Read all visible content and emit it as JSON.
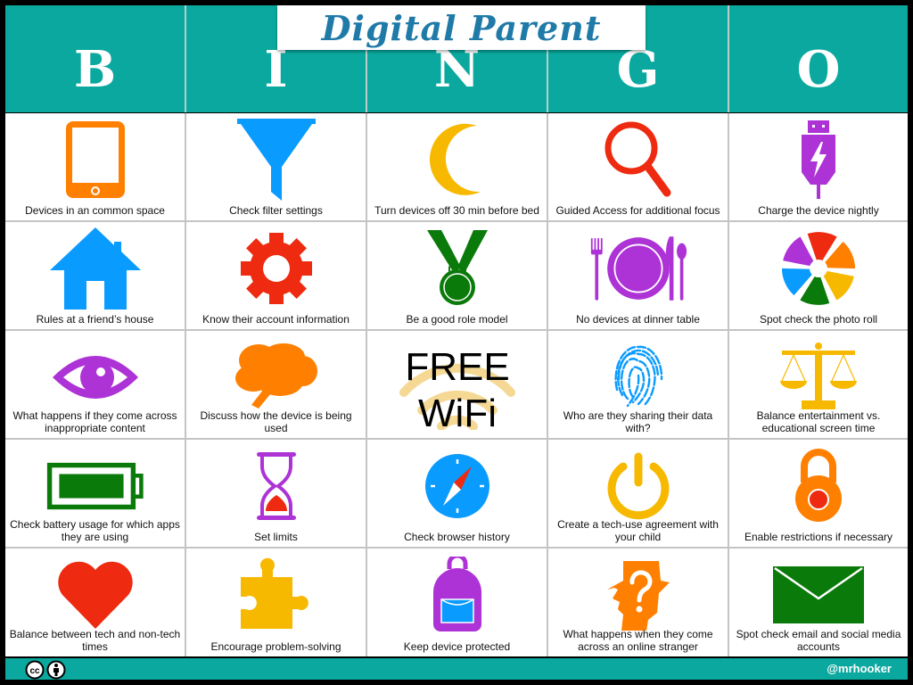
{
  "title": "Digital Parent",
  "header_letters": [
    "B",
    "I",
    "N",
    "G",
    "O"
  ],
  "colors": {
    "teal": "#0aa89e",
    "title_blue": "#1f7aa8",
    "orange": "#ff7f00",
    "blue": "#0a9bff",
    "yellow": "#f7b900",
    "red": "#ee2a10",
    "purple": "#ad33d6",
    "green": "#0a7a0a"
  },
  "cells": [
    [
      {
        "icon": "tablet-icon",
        "label": "Devices in an common space"
      },
      {
        "icon": "funnel-filter-icon",
        "label": "Check filter settings"
      },
      {
        "icon": "crescent-moon-icon",
        "label": "Turn devices off 30 min before bed"
      },
      {
        "icon": "magnifying-glass-icon",
        "label": "Guided Access for additional focus"
      },
      {
        "icon": "usb-charge-icon",
        "label": "Charge the device nightly"
      }
    ],
    [
      {
        "icon": "house-icon",
        "label": "Rules at a friend’s house"
      },
      {
        "icon": "gear-icon",
        "label": "Know their account information"
      },
      {
        "icon": "medal-icon",
        "label": "Be a good role model"
      },
      {
        "icon": "plate-utensils-icon",
        "label": "No devices at dinner table"
      },
      {
        "icon": "camera-aperture-icon",
        "label": "Spot check the photo roll"
      }
    ],
    [
      {
        "icon": "eye-icon",
        "label": "What happens if they come across inappropriate content"
      },
      {
        "icon": "brain-icon",
        "label": "Discuss how the device is being used"
      },
      {
        "icon": "wifi-icon",
        "label": "",
        "free_text_1": "FREE",
        "free_text_2": "WiFi"
      },
      {
        "icon": "fingerprint-icon",
        "label": "Who are they sharing their data with?"
      },
      {
        "icon": "balance-scale-icon",
        "label": "Balance entertainment vs. educational screen time"
      }
    ],
    [
      {
        "icon": "battery-icon",
        "label": "Check battery usage for which apps they are using"
      },
      {
        "icon": "hourglass-icon",
        "label": "Set limits"
      },
      {
        "icon": "compass-icon",
        "label": "Check browser history"
      },
      {
        "icon": "power-icon",
        "label": "Create a tech-use agreement with your child"
      },
      {
        "icon": "padlock-icon",
        "label": "Enable restrictions if necessary"
      }
    ],
    [
      {
        "icon": "heart-icon",
        "label": "Balance between tech and non-tech times"
      },
      {
        "icon": "puzzle-piece-icon",
        "label": "Encourage problem-solving"
      },
      {
        "icon": "backpack-icon",
        "label": "Keep device protected"
      },
      {
        "icon": "stranger-question-icon",
        "label": "What happens when they come across an online stranger"
      },
      {
        "icon": "envelope-icon",
        "label": "Spot check email and social media accounts"
      }
    ]
  ],
  "footer": {
    "license_icons": [
      "creative-commons-icon",
      "attribution-icon"
    ],
    "cc_text": "cc",
    "handle": "@mrhooker"
  }
}
